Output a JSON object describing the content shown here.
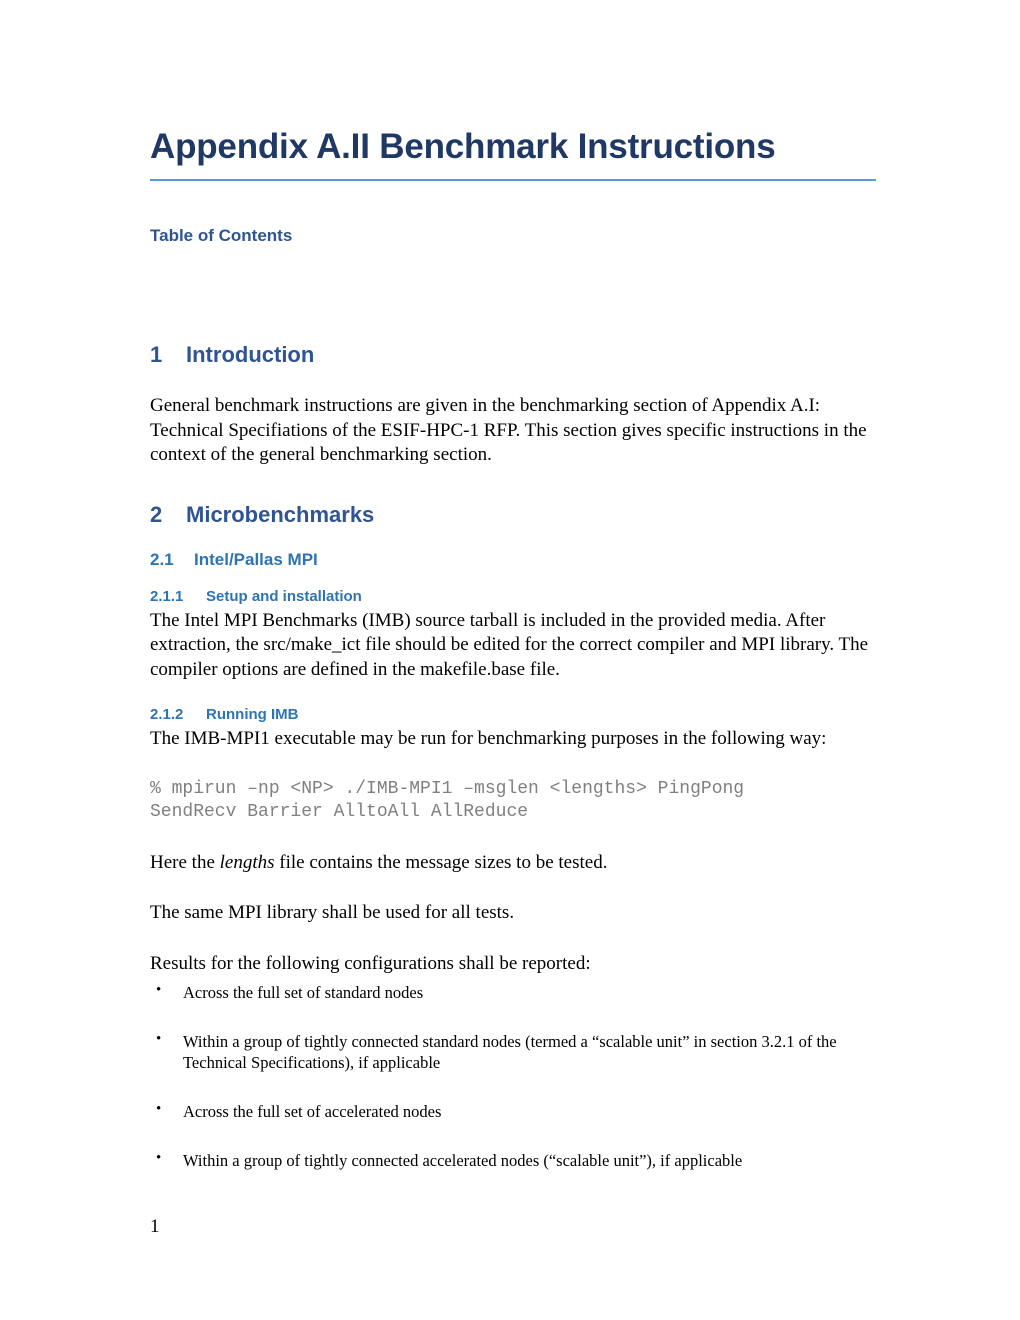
{
  "document": {
    "title": "Appendix A.II Benchmark Instructions",
    "page_number": "1",
    "toc_heading": "Table of Contents",
    "colors": {
      "title": "#1F3864",
      "title_rule": "#5B9BD5",
      "heading1": "#2F5496",
      "heading2": "#2E74B5",
      "heading3": "#2E74B5",
      "body_text": "#000000",
      "code_text": "#808080"
    }
  },
  "sections": {
    "introduction": {
      "number": "1",
      "title": "Introduction",
      "paragraph": "General benchmark instructions are given in the benchmarking section of Appendix A.I: Technical Specifiations of the ESIF-HPC-1 RFP. This section gives specific instructions in the context of the general benchmarking section."
    },
    "microbenchmarks": {
      "number": "2",
      "title": "Microbenchmarks",
      "intel_pallas": {
        "number": "2.1",
        "title": "Intel/Pallas MPI",
        "setup": {
          "number": "2.1.1",
          "title": "Setup and installation",
          "paragraph": "The Intel MPI Benchmarks (IMB) source tarball is included in the provided media. After extraction, the src/make_ict file should be edited for the correct compiler and MPI library. The compiler options are defined in the makefile.base file."
        },
        "running": {
          "number": "2.1.2",
          "title": "Running IMB",
          "intro_paragraph": "The IMB-MPI1 executable may be run for benchmarking purposes in the following way:",
          "command": "% mpirun –np <NP> ./IMB-MPI1 –msglen <lengths> PingPong\nSendRecv Barrier AlltoAll AllReduce",
          "note_before_italic": "Here the ",
          "note_italic": "lengths",
          "note_after_italic": " file contains the message sizes to be tested.",
          "library_paragraph": "The same MPI library shall be used for all tests.",
          "results_lead_in": "Results for the following configurations shall be reported:",
          "bullet_glyph": "•",
          "bullets": [
            "Across the full set of standard nodes",
            "Within a group of tightly connected standard nodes (termed a “scalable unit” in section 3.2.1 of the Technical Specifications), if applicable",
            "Across the full set of accelerated nodes",
            "Within a group of tightly connected accelerated nodes (“scalable unit”), if applicable"
          ]
        }
      }
    }
  }
}
